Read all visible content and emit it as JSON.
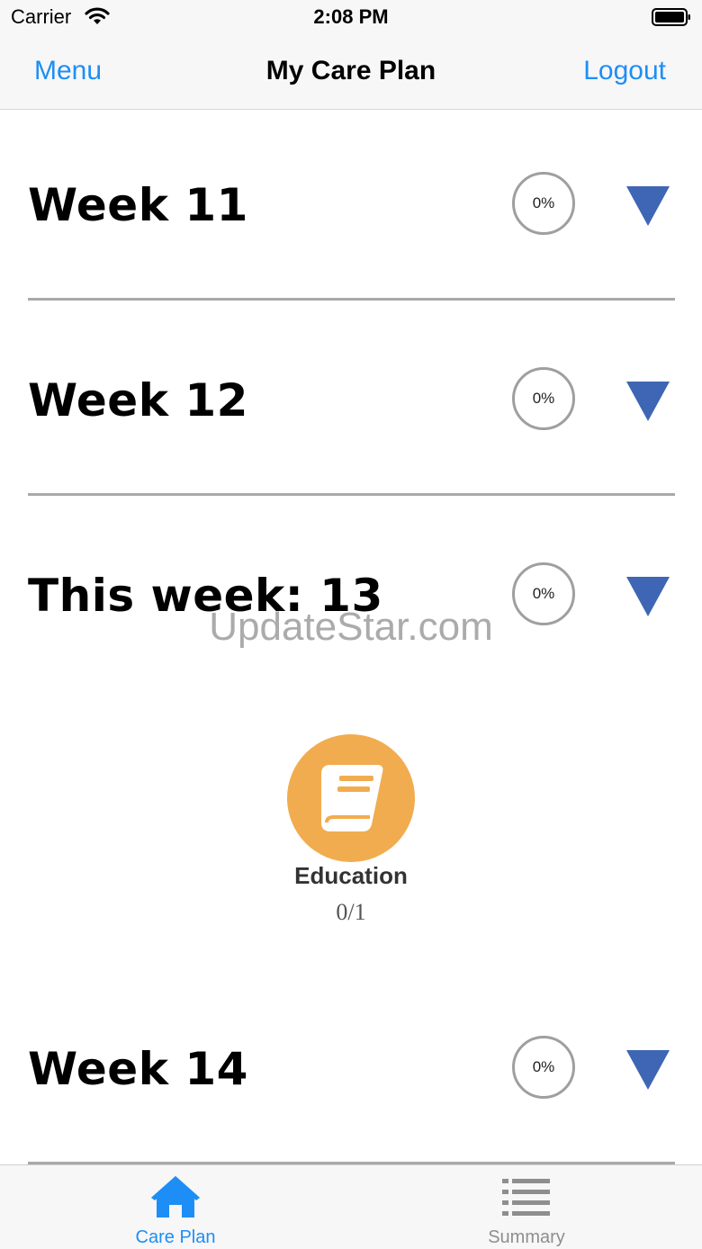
{
  "status_bar": {
    "carrier": "Carrier",
    "time": "2:08 PM"
  },
  "nav": {
    "menu_label": "Menu",
    "title": "My Care Plan",
    "logout_label": "Logout"
  },
  "weeks": [
    {
      "title": "Week 11",
      "progress": "0%"
    },
    {
      "title": "Week 12",
      "progress": "0%"
    },
    {
      "title": "This week: 13",
      "progress": "0%"
    },
    {
      "title": "Week 14",
      "progress": "0%"
    }
  ],
  "watermark": "UpdateStar.com",
  "activity": {
    "label": "Education",
    "count": "0/1",
    "icon": "book-icon"
  },
  "tabs": [
    {
      "label": "Care Plan",
      "icon": "home-icon",
      "selected": true
    },
    {
      "label": "Summary",
      "icon": "list-icon",
      "selected": false
    }
  ],
  "colors": {
    "accent": "#1d8ef5",
    "expand_arrow": "#3f66b4",
    "activity_circle": "#f1ac4f",
    "inactive_tab": "#8e8e8e"
  }
}
